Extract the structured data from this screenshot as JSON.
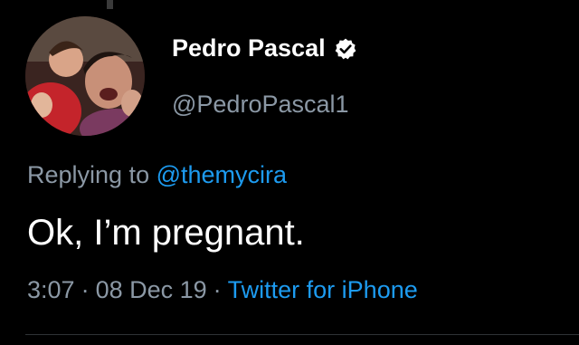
{
  "author": {
    "display_name": "Pedro Pascal",
    "handle": "@PedroPascal1",
    "verified_icon": "verified-badge-icon"
  },
  "reply": {
    "prefix": "Replying to",
    "handle": "@themycira"
  },
  "tweet": {
    "text": "Ok, I’m pregnant."
  },
  "meta": {
    "time": "3:07",
    "separator": "·",
    "date": "08 Dec 19",
    "source": "Twitter for iPhone"
  },
  "colors": {
    "background": "#000000",
    "primary_text": "#ffffff",
    "secondary_text": "#8b98a5",
    "link": "#1d9bf0",
    "divider": "#2f3336"
  }
}
